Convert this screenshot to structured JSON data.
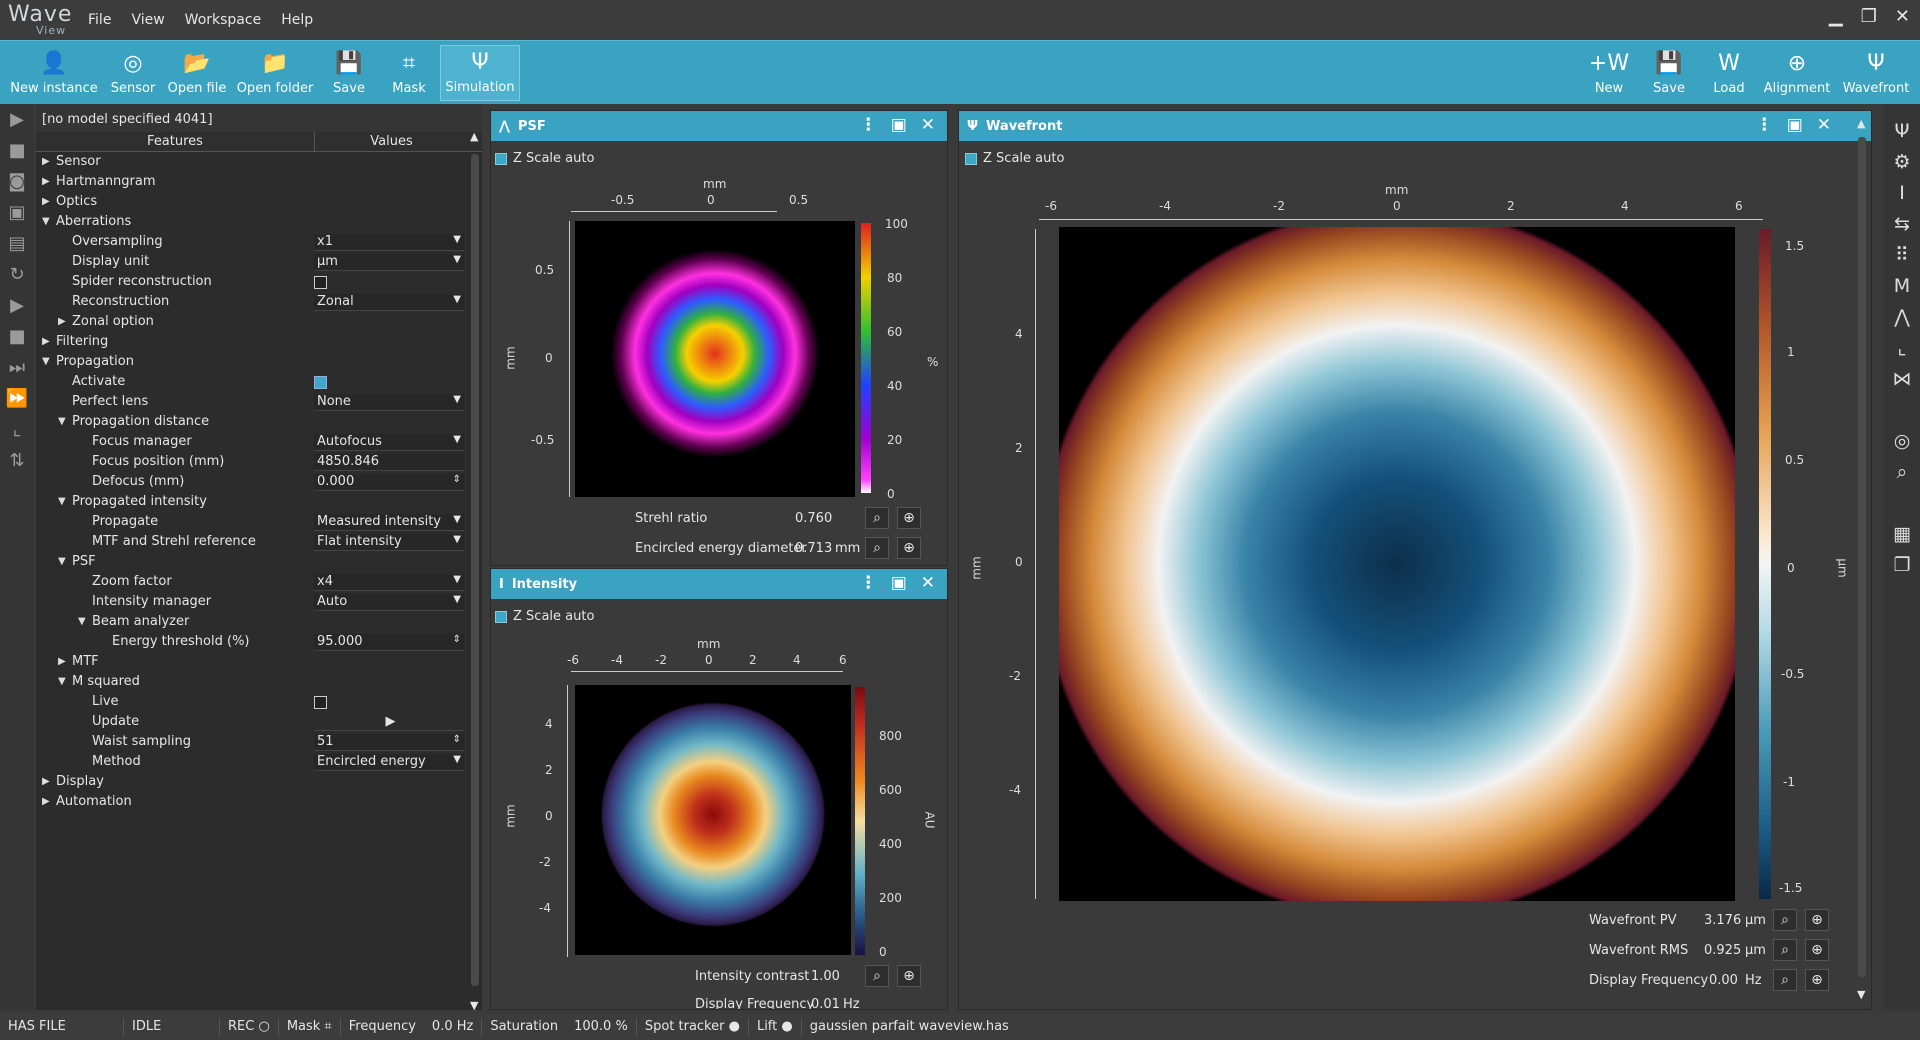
{
  "app": {
    "logo_main": "Wave",
    "logo_sub": "View"
  },
  "menu": [
    "File",
    "View",
    "Workspace",
    "Help"
  ],
  "window_controls": {
    "minimize": "▁",
    "restore": "❐",
    "close": "✕"
  },
  "toolbar": {
    "left": [
      {
        "label": "New instance",
        "icon": "user-plus-icon",
        "glyph": "👤"
      },
      {
        "label": "Sensor",
        "icon": "aperture-icon",
        "glyph": "◎"
      },
      {
        "label": "Open file",
        "icon": "folder-icon",
        "glyph": "📂"
      },
      {
        "label": "Open folder",
        "icon": "folder-open-icon",
        "glyph": "📁"
      },
      {
        "label": "Save",
        "icon": "save-icon",
        "glyph": "💾"
      },
      {
        "label": "Mask",
        "icon": "crop-icon",
        "glyph": "⌗"
      },
      {
        "label": "Simulation",
        "icon": "psi-icon",
        "glyph": "Ψ"
      }
    ],
    "right": [
      {
        "label": "New",
        "icon": "new-wavefront-icon",
        "glyph": "+W"
      },
      {
        "label": "Save",
        "icon": "save-wavefront-icon",
        "glyph": "💾"
      },
      {
        "label": "Load",
        "icon": "load-wavefront-icon",
        "glyph": "W"
      },
      {
        "label": "Alignment",
        "icon": "alignment-icon",
        "glyph": "⊕"
      },
      {
        "label": "Wavefront",
        "icon": "wavefront-psi-icon",
        "glyph": "Ψ"
      }
    ]
  },
  "properties": {
    "model": "[no model specified 4041]",
    "col_features": "Features",
    "col_values": "Values",
    "rows": [
      {
        "label": "Sensor",
        "level": 0,
        "tri": "▶"
      },
      {
        "label": "Hartmanngram",
        "level": 0,
        "tri": "▶"
      },
      {
        "label": "Optics",
        "level": 0,
        "tri": "▶"
      },
      {
        "label": "Aberrations",
        "level": 0,
        "tri": "▼"
      },
      {
        "label": "Oversampling",
        "level": 1,
        "value": "x1",
        "kind": "dd"
      },
      {
        "label": "Display unit",
        "level": 1,
        "value": "µm",
        "kind": "dd"
      },
      {
        "label": "Spider reconstruction",
        "level": 1,
        "kind": "cb"
      },
      {
        "label": "Reconstruction",
        "level": 1,
        "value": "Zonal",
        "kind": "dd"
      },
      {
        "label": "Zonal option",
        "level": 1,
        "tri": "▶"
      },
      {
        "label": "Filtering",
        "level": 0,
        "tri": "▶"
      },
      {
        "label": "Propagation",
        "level": 0,
        "tri": "▼"
      },
      {
        "label": "Activate",
        "level": 1,
        "kind": "cbon"
      },
      {
        "label": "Perfect lens",
        "level": 1,
        "value": "None",
        "kind": "dd"
      },
      {
        "label": "Propagation distance",
        "level": 1,
        "tri": "▼"
      },
      {
        "label": "Focus manager",
        "level": 2,
        "value": "Autofocus",
        "kind": "dd"
      },
      {
        "label": "Focus position (mm)",
        "level": 2,
        "value": "4850.846",
        "kind": "txt"
      },
      {
        "label": "Defocus (mm)",
        "level": 2,
        "value": "0.000",
        "kind": "spin"
      },
      {
        "label": "Propagated intensity",
        "level": 1,
        "tri": "▼"
      },
      {
        "label": "Propagate",
        "level": 2,
        "value": "Measured intensity",
        "kind": "dd"
      },
      {
        "label": "MTF and Strehl reference",
        "level": 2,
        "value": "Flat intensity",
        "kind": "dd"
      },
      {
        "label": "PSF",
        "level": 1,
        "tri": "▼"
      },
      {
        "label": "Zoom factor",
        "level": 2,
        "value": "x4",
        "kind": "dd"
      },
      {
        "label": "Intensity manager",
        "level": 2,
        "value": "Auto",
        "kind": "dd"
      },
      {
        "label": "Beam analyzer",
        "level": 2,
        "tri": "▼"
      },
      {
        "label": "Energy threshold (%)",
        "level": 3,
        "value": "95.000",
        "kind": "spin"
      },
      {
        "label": "MTF",
        "level": 1,
        "tri": "▶"
      },
      {
        "label": "M squared",
        "level": 1,
        "tri": "▼"
      },
      {
        "label": "Live",
        "level": 2,
        "kind": "cb"
      },
      {
        "label": "Update",
        "level": 2,
        "value": "▶",
        "kind": "play"
      },
      {
        "label": "Waist sampling",
        "level": 2,
        "value": "51",
        "kind": "spin"
      },
      {
        "label": "Method",
        "level": 2,
        "value": "Encircled energy",
        "kind": "dd"
      },
      {
        "label": "Display",
        "level": 0,
        "tri": "▶"
      },
      {
        "label": "Automation",
        "level": 0,
        "tri": "▶"
      }
    ]
  },
  "psf": {
    "title": "PSF",
    "zscale": "Z Scale auto",
    "axis_unit_x": "mm",
    "axis_unit_y": "mm",
    "cbar_unit": "%",
    "xticks": [
      "-0.5",
      "0",
      "0.5"
    ],
    "yticks": [
      "0.5",
      "0",
      "-0.5"
    ],
    "cbar_ticks": [
      "100",
      "80",
      "60",
      "40",
      "20",
      "0"
    ],
    "strehl_label": "Strehl ratio",
    "strehl_value": "0.760",
    "ee_label": "Encircled energy diameter",
    "ee_value": "0.713",
    "ee_unit": "mm"
  },
  "intensity": {
    "title": "Intensity",
    "zscale": "Z Scale auto",
    "axis_unit_x": "mm",
    "axis_unit_y": "mm",
    "cbar_unit": "AU",
    "xticks": [
      "-6",
      "-4",
      "-2",
      "0",
      "2",
      "4",
      "6"
    ],
    "yticks": [
      "4",
      "2",
      "0",
      "-2",
      "-4"
    ],
    "cbar_ticks": [
      "800",
      "600",
      "400",
      "200",
      "0"
    ],
    "contrast_label": "Intensity contrast",
    "contrast_value": "1.00",
    "freq_label": "Display Frequency",
    "freq_value": "0.01",
    "freq_unit": "Hz"
  },
  "wavefront": {
    "title": "Wavefront",
    "zscale": "Z Scale auto",
    "axis_unit_x": "mm",
    "axis_unit_y": "mm",
    "cbar_unit": "µm",
    "xticks": [
      "-6",
      "-4",
      "-2",
      "0",
      "2",
      "4",
      "6"
    ],
    "yticks": [
      "4",
      "2",
      "0",
      "-2",
      "-4"
    ],
    "cbar_ticks": [
      "1.5",
      "1",
      "0.5",
      "0",
      "-0.5",
      "-1",
      "-1.5"
    ],
    "pv_label": "Wavefront PV",
    "pv_value": "3.176",
    "pv_unit": "µm",
    "rms_label": "Wavefront RMS",
    "rms_value": "0.925",
    "rms_unit": "µm",
    "freq_label": "Display Frequency",
    "freq_value": "0.00",
    "freq_unit": "Hz"
  },
  "status": [
    "HAS FILE",
    "IDLE",
    "REC",
    "Mask",
    "Frequency",
    "0.0 Hz",
    "Saturation",
    "100.0 %",
    "Spot tracker",
    "Lift",
    "gaussien parfait waveview.has"
  ],
  "colors": {
    "accent": "#3aa3c1",
    "bg": "#3a3a3a"
  }
}
